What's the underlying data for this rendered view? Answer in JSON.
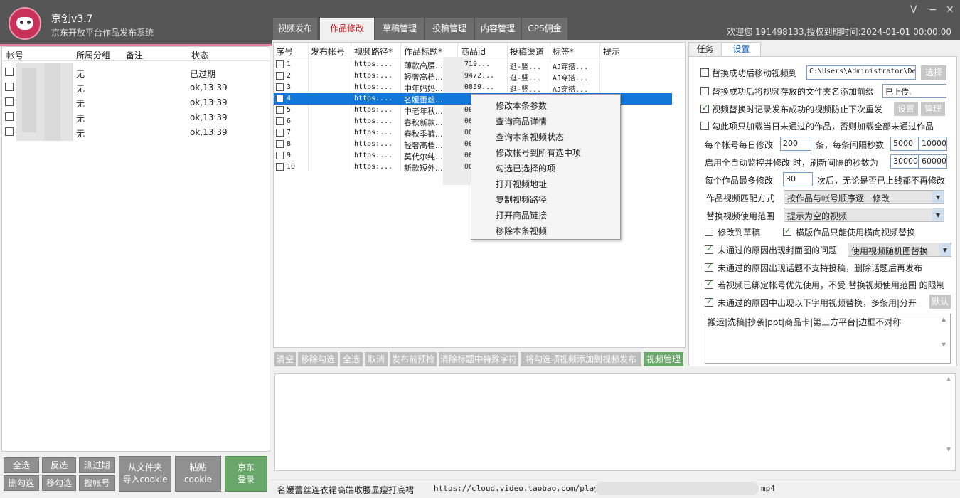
{
  "app": {
    "title": "京创v3.7",
    "subtitle": "京东开放平台作品发布系统",
    "welcome": "欢迎您 191498133,授权到期时间:2024-01-01 00:00:00"
  },
  "window_controls": [
    "V",
    "−",
    "✕"
  ],
  "tabs": [
    "视频发布",
    "作品修改",
    "草稿管理",
    "投稿管理",
    "内容管理",
    "CPS佣金"
  ],
  "active_tab": "作品修改",
  "accounts": {
    "headers": [
      "帐号",
      "所属分组",
      "备注",
      "状态"
    ],
    "rows": [
      {
        "group": "无",
        "status": "已过期"
      },
      {
        "group": "无",
        "status": "ok,13:39"
      },
      {
        "group": "无",
        "status": "ok,13:39"
      },
      {
        "group": "无",
        "status": "ok,13:39"
      },
      {
        "group": "无",
        "status": "ok,13:39"
      }
    ]
  },
  "left_buttons": {
    "select_all": "全选",
    "invert": "反选",
    "test_expired": "测过期",
    "delete_checked": "删勾选",
    "move_checked": "移勾选",
    "search_account": "搜帐号",
    "import_file": "从文件夹\n导入cookie",
    "paste_cookie": "粘贴\ncookie",
    "jd_login": "京东\n登录"
  },
  "works": {
    "headers": [
      "序号",
      "发布帐号",
      "视频路径*",
      "作品标题*",
      "商品id",
      "投稿渠道",
      "标签*",
      "提示"
    ],
    "rows": [
      {
        "no": "1",
        "path": "https:...",
        "title": "薄款高腰...",
        "pid": "719...",
        "channel": "逛-竖...",
        "tag": "AJ穿搭..."
      },
      {
        "no": "2",
        "path": "https:...",
        "title": "轻奢高档...",
        "pid": "9472...",
        "channel": "逛-竖...",
        "tag": "AJ穿搭..."
      },
      {
        "no": "3",
        "path": "https:...",
        "title": "中年妈妈...",
        "pid": "0839...",
        "channel": "逛-竖...",
        "tag": "AJ穿搭..."
      },
      {
        "no": "4",
        "path": "https:...",
        "title": "名媛蕾丝...",
        "pid": "",
        "channel": "",
        "tag": ""
      },
      {
        "no": "5",
        "path": "https:...",
        "title": "中老年秋...",
        "pid": "00",
        "channel": "",
        "tag": ""
      },
      {
        "no": "6",
        "path": "https:...",
        "title": "春秋新款...",
        "pid": "00",
        "channel": "",
        "tag": ""
      },
      {
        "no": "7",
        "path": "https:...",
        "title": "春秋季裤...",
        "pid": "00",
        "channel": "",
        "tag": ""
      },
      {
        "no": "8",
        "path": "https:...",
        "title": "轻奢高档...",
        "pid": "00",
        "channel": "",
        "tag": ""
      },
      {
        "no": "9",
        "path": "https:...",
        "title": "莫代尔纯...",
        "pid": "00",
        "channel": "",
        "tag": ""
      },
      {
        "no": "10",
        "path": "https:...",
        "title": "新款短外...",
        "pid": "00",
        "channel": "",
        "tag": ""
      }
    ],
    "selected_row": 4
  },
  "context_menu": [
    "修改本条参数",
    "查询商品详情",
    "查询本条视频状态",
    "修改帐号到所有选中项",
    "勾选已选择的项",
    "打开视频地址",
    "复制视频路径",
    "打开商品链接",
    "移除本条视频"
  ],
  "toolbar": [
    "清空",
    "移除勾选",
    "全选",
    "取消",
    "发布前预检",
    "清除标题中特殊字符",
    "将勾选项视频添加到视频发布",
    "视频管理"
  ],
  "right_tabs": [
    "任务",
    "设置"
  ],
  "settings": {
    "move_after_replace": "替换成功后移动视频到",
    "move_path": "C:\\Users\\Administrator\\De",
    "choose": "选择",
    "add_prefix": "替换成功后将视频存放的文件夹名添加前缀",
    "prefix_value": "已上传,",
    "record_success": "视频替换时记录发布成功的视频防止下次重发",
    "set_btn": "设置",
    "manage_btn": "管理",
    "only_today": "勾此项只加载当日未通过的作品，否则加载全部未通过作品",
    "daily_prefix": "每个帐号每日修改",
    "daily_value": "200",
    "daily_mid": "条，每条间隔秒数",
    "interval_min": "5000",
    "interval_max": "10000",
    "auto_monitor": "启用全自动监控并修改 时，刷新间隔的秒数为",
    "refresh_min": "30000",
    "refresh_max": "60000",
    "max_prefix": "每个作品最多修改",
    "max_value": "30",
    "max_suffix": "次后，无论是否已上线都不再修改",
    "match_label": "作品视频匹配方式",
    "match_value": "按作品与帐号顺序逐一修改",
    "range_label": "替换视频使用范围",
    "range_value": "提示为空的视频",
    "to_draft": "修改到草稿",
    "landscape_only": "横版作品只能使用横向视频替换",
    "cover_issue": "未通过的原因出现封面图的问题",
    "cover_value": "使用视频随机图替换",
    "topic_issue": "未通过的原因出现话题不支持投稿，删除话题后再发布",
    "bound_first": "若视频已绑定帐号优先使用，不受 替换视频使用范围 的限制",
    "keyword_issue": "未通过的原因中出现以下字用视频替换，多条用|分开",
    "default_btn": "默认",
    "keywords": "搬运|洗稿|抄袭|ppt|商品卡|第三方平台|边框不对称"
  },
  "statusbar": {
    "title": "名媛蕾丝连衣裙高端收腰显瘦打底裙",
    "url": "https://cloud.video.taobao.com/play/u",
    "suffix": "mp4"
  }
}
